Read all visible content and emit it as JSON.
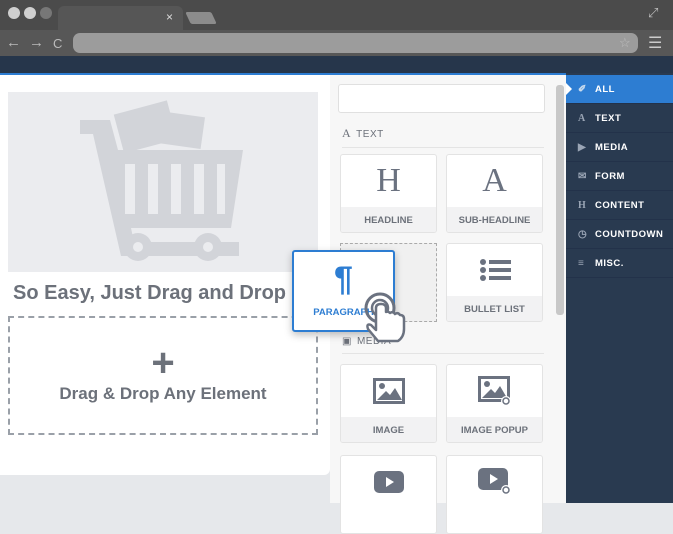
{
  "browser": {
    "tab_close": "×",
    "back": "←",
    "forward": "→",
    "reload": "C",
    "star": "☆",
    "menu": "☰",
    "maximize": "⤢"
  },
  "canvas": {
    "headline": "So Easy, Just Drag and Drop",
    "drop_plus": "+",
    "drop_label": "Drag & Drop Any Element"
  },
  "panel": {
    "search_placeholder": "",
    "sections": [
      {
        "icon": "A",
        "label": "TEXT"
      },
      {
        "icon": "▣",
        "label": "MEDIA"
      }
    ],
    "tiles": [
      {
        "icon": "H",
        "label": "HEADLINE"
      },
      {
        "icon": "A",
        "label": "SUB-HEADLINE"
      },
      {
        "icon": "bullet-list-icon",
        "label": "BULLET LIST"
      },
      {
        "icon": "image-icon",
        "label": "IMAGE"
      },
      {
        "icon": "image-popup-icon",
        "label": "IMAGE POPUP"
      },
      {
        "icon": "video-icon",
        "label": ""
      },
      {
        "icon": "video-popup-icon",
        "label": ""
      }
    ],
    "dragging": {
      "icon": "¶",
      "label": "PARAGRAPH"
    }
  },
  "sidebar": {
    "items": [
      {
        "icon": "✐",
        "label": "ALL",
        "active": true
      },
      {
        "icon": "A",
        "label": "TEXT"
      },
      {
        "icon": "▶",
        "label": "MEDIA"
      },
      {
        "icon": "✉",
        "label": "FORM"
      },
      {
        "icon": "H",
        "label": "CONTENT"
      },
      {
        "icon": "◷",
        "label": "COUNTDOWN"
      },
      {
        "icon": "≡",
        "label": "MISC."
      }
    ]
  },
  "colors": {
    "accent": "#2d7dd2",
    "sidebar": "#293a50",
    "text": "#6c717a"
  }
}
